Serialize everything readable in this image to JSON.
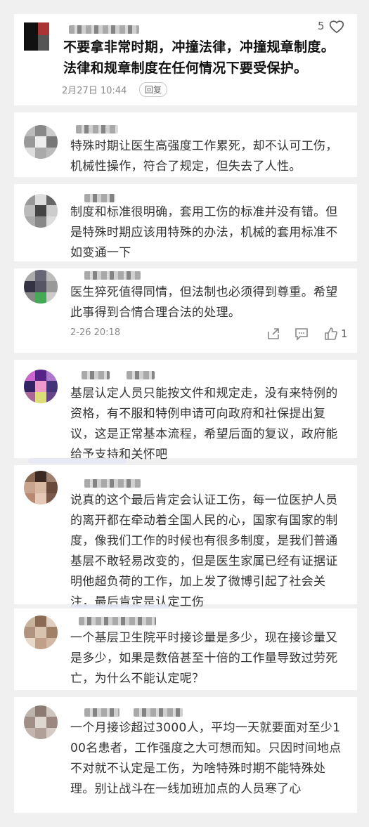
{
  "comments": [
    {
      "text": "不要拿非常时期，冲撞法律，冲撞规章制度。法律和规章制度在任何情况下要受保护。",
      "date": "2月27日 10:44",
      "reply_label": "回复",
      "likes": "5"
    },
    {
      "text": "特殊时期让医生高强度工作累死，却不认可工伤，机械性操作，符合了规定，但失去了人性。"
    },
    {
      "text": "制度和标准很明确，套用工伤的标准并没有错。但是特殊时期应该用特殊的办法，机械的套用标准不如变通一下"
    },
    {
      "text": "医生猝死值得同情，但法制也必须得到尊重。希望此事得到合情合理合法的处理。",
      "date": "2-26 20:18",
      "likes": "1"
    },
    {
      "text": "基层认定人员只能按文件和规定走，没有来特例的资格，有不服和特例申请可向政府和社保提出复议，这是正常基本流程，希望后面的复议，政府能给予支持和关怀吧"
    },
    {
      "text": "说真的这个最后肯定会认证工伤，每一位医护人员的离开都在牵动着全国人民的心，国家有国家的制度，像我们工作的时候也有很多制度，是我们普通基层不敢轻易改变的，但是医生家属已经有证据证明他超负荷的工作，加上发了微博引起了社会关注，最后肯定是认定工伤"
    },
    {
      "text": "一个基层卫生院平时接诊量是多少，现在接诊量又是多少，如果是数倍甚至十倍的工作量导致过劳死亡，为什么不能认定呢？"
    },
    {
      "text": "一个月接诊超过3000人，平均一天就要面对至少100名患者，工作强度之大可想而知。只因时间地点不对就不认定是工伤，为啥特殊时期不能特殊处理。别让战斗在一线加班加点的人员寒了心"
    }
  ]
}
